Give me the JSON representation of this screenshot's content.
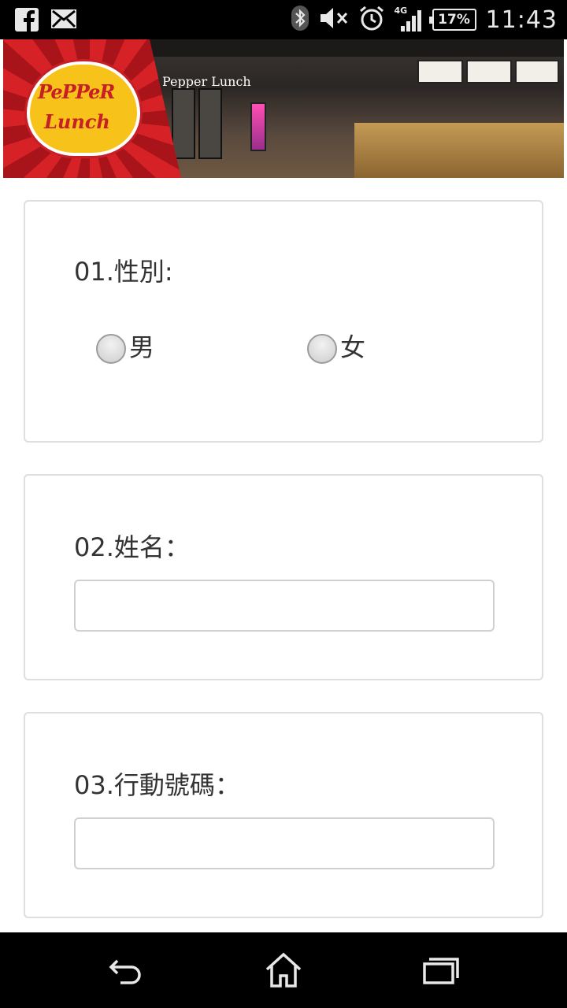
{
  "status_bar": {
    "time": "11:43",
    "battery": "17%",
    "network": "4G",
    "icons": [
      "facebook-icon",
      "email-icon",
      "bluetooth-icon",
      "mute-icon",
      "alarm-icon",
      "signal-icon",
      "battery-icon"
    ]
  },
  "banner": {
    "logo_line1": "PePPeR",
    "logo_line2": "Lunch",
    "store_sign": "Pepper Lunch"
  },
  "form": {
    "q1": {
      "label": "01.性別:",
      "options": [
        "男",
        "女"
      ]
    },
    "q2": {
      "label": "02.姓名：",
      "value": "",
      "placeholder": ""
    },
    "q3": {
      "label": "03.行動號碼：",
      "value": "",
      "placeholder": ""
    }
  },
  "nav_bar": {
    "icons": [
      "back-icon",
      "home-icon",
      "recent-apps-icon"
    ]
  },
  "colors": {
    "status_bg": "#000000",
    "banner_red": "#d62126",
    "logo_yellow": "#f7c31a",
    "card_border": "#dedede",
    "text": "#333333"
  }
}
